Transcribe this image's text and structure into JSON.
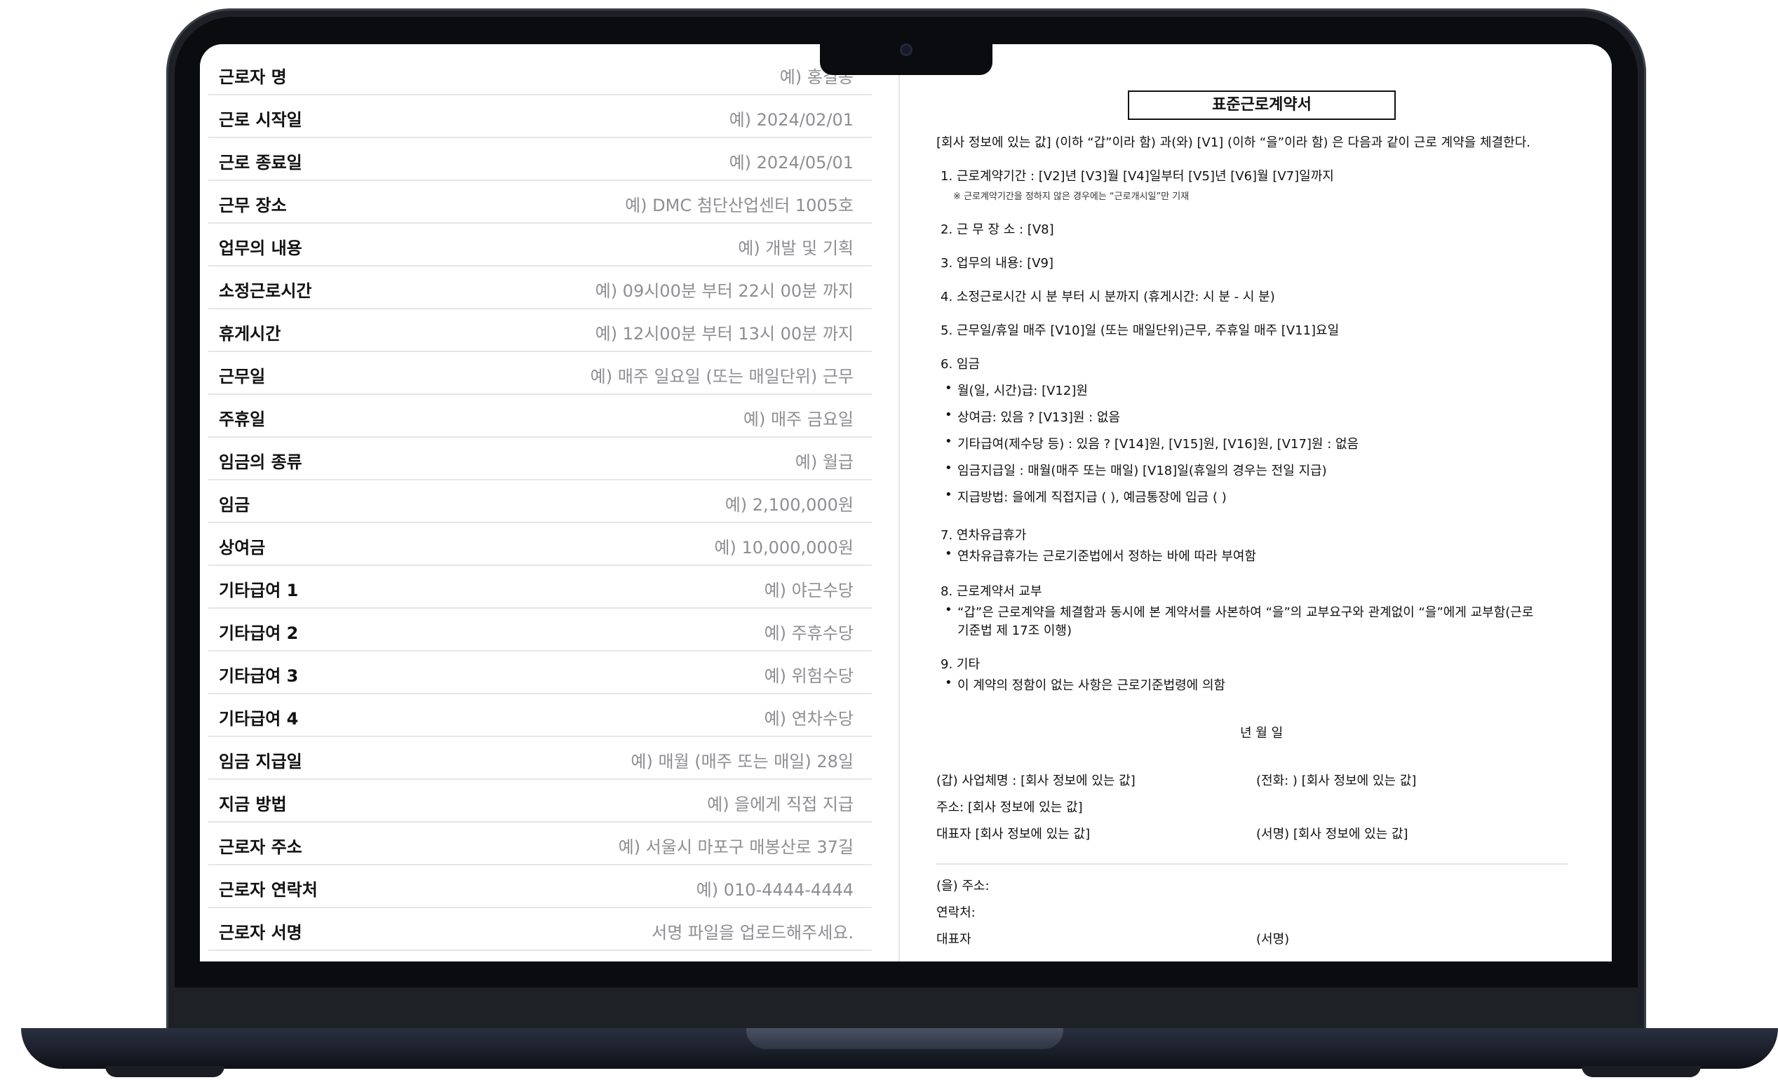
{
  "form": {
    "rows": [
      {
        "label": "근로자 명",
        "value": "예) 홍길동"
      },
      {
        "label": "근로 시작일",
        "value": "예) 2024/02/01"
      },
      {
        "label": "근로 종료일",
        "value": "예) 2024/05/01"
      },
      {
        "label": "근무 장소",
        "value": "예) DMC 첨단산업센터 1005호"
      },
      {
        "label": "업무의 내용",
        "value": "예) 개발 및 기획"
      },
      {
        "label": "소정근로시간",
        "value": "예) 09시00분 부터 22시 00분 까지"
      },
      {
        "label": "휴게시간",
        "value": "예) 12시00분 부터 13시 00분 까지"
      },
      {
        "label": "근무일",
        "value": "예) 매주 일요일 (또는 매일단위) 근무"
      },
      {
        "label": "주휴일",
        "value": "예) 매주 금요일"
      },
      {
        "label": "임금의 종류",
        "value": "예) 월급"
      },
      {
        "label": "임금",
        "value": "예) 2,100,000원"
      },
      {
        "label": "상여금",
        "value": "예) 10,000,000원"
      },
      {
        "label": "기타급여 1",
        "value": "예) 야근수당"
      },
      {
        "label": "기타급여 2",
        "value": "예) 주휴수당"
      },
      {
        "label": "기타급여 3",
        "value": "예) 위험수당"
      },
      {
        "label": "기타급여 4",
        "value": "예) 연차수당"
      },
      {
        "label": "임금 지급일",
        "value": "예) 매월 (매주 또는 매일) 28일"
      },
      {
        "label": "지금 방법",
        "value": "예) 을에게 직접 지급"
      },
      {
        "label": "근로자 주소",
        "value": "예) 서울시 마포구 매봉산로 37길"
      },
      {
        "label": "근로자 연락처",
        "value": "예) 010-4444-4444"
      },
      {
        "label": "근로자 서명",
        "value": "서명 파일을 업로드해주세요."
      }
    ]
  },
  "document": {
    "title": "표준근로계약서",
    "intro": "[회사 정보에 있는 값] (이하 “갑”이라 함) 과(와) [V1] (이하 “을”이라 함) 은 다음과 같이 근로 계약을 체결한다.",
    "item1": "1. 근로계약기간 :   [V2]년 [V3]월 [V4]일부터 [V5]년 [V6]월 [V7]일까지",
    "item1_note": "※ 근로계약기간을 정하지 않은 경우에는 “근로개시일”만 기재",
    "item2": "2. 근  무  장  소 :   [V8]",
    "item3": "3. 업무의 내용:      [V9]",
    "item4": "4. 소정근로시간     시 분 부터 시 분까지 (휴게시간: 시 분 - 시 분)",
    "item5": "5. 근무일/휴일       매주 [V10]일 (또는 매일단위)근무, 주휴일 매주 [V11]요일",
    "item6": "6. 임금",
    "item6_bullets": [
      "월(일, 시간)급: [V12]원",
      "상여금: 있음 ? [V13]원 : 없음",
      "기타급여(제수당 등) : 있음 ?  [V14]원, [V15]원, [V16]원, [V17]원 : 없음",
      "임금지급일 : 매월(매주 또는 매일) [V18]일(휴일의 경우는 전일 지급)",
      "지급방법: 을에게 직접지급 ( ), 예금통장에 입금 ( )"
    ],
    "item7": "7. 연차유급휴가",
    "item7_bullet": "연차유급휴가는 근로기준법에서 정하는 바에 따라 부여함",
    "item8": "8. 근로계약서 교부",
    "item8_bullet_line1": "“갑”은 근로계약을 체결함과 동시에 본 계약서를 사본하여 “을”의 교부요구와 관계없이 “을”에게 교부함(근로",
    "item8_bullet_line2": "기준법 제 17조 이행)",
    "item9": "9. 기타",
    "item9_bullet": "이 계약의 정함이 없는 사항은 근로기준법령에 의함",
    "date_line": "년 월 일",
    "employer_name": "(갑) 사업체명 : [회사 정보에 있는 값]",
    "employer_phone": "(전화: ) [회사 정보에 있는 값]",
    "employer_address": "주소:  [회사 정보에 있는 값]",
    "employer_rep": "대표자  [회사 정보에 있는 값]",
    "employer_sign": "(서명) [회사 정보에 있는 값]",
    "employee_address": "(을) 주소:",
    "employee_contact": "연락처:",
    "employee_rep": "대표자",
    "employee_sign": "(서명)"
  }
}
